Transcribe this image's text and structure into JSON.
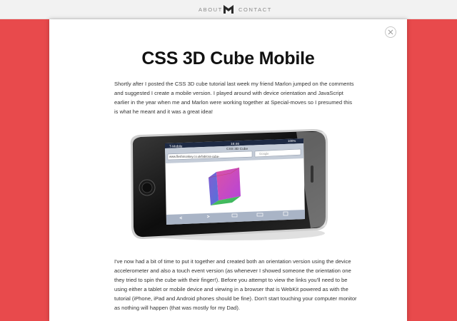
{
  "nav": {
    "about_label": "ABOUT",
    "contact_label": "CONTACT"
  },
  "article": {
    "title": "CSS 3D Cube Mobile",
    "intro": "Shortly after I posted the CSS 3D cube tutorial last week my friend Marlon jumped on the comments and suggested I create a mobile version. I played around with device orientation and JavaScript earlier in the year when me and Marlon were working together at Special-moves so I presumed this is what he meant and it was a great idea!",
    "body": "I've now had a bit of time to put it together and created both an orientation version using the device accelerometer and also a touch event version (as whenever I showed someone the orientation one they tried to spin the cube with their finger!). Before you attempt to view the links you'll need to be using either a tablet or mobile device and viewing in a browser that is WebKit powered as with the tutorial (iPhone, iPad and Android phones should be fine). Don't start touching your computer monitor as nothing will happen (that was mostly for my Dad)."
  },
  "phone_screen": {
    "carrier": "T-Mobile",
    "time": "16:46",
    "battery": "100%",
    "page_title": "CSS 3D Cube",
    "url": "www.fleshmonkey.co.uk/lab/css-cube-",
    "search_placeholder": "Google"
  },
  "colors": {
    "background": "#e84a4c",
    "topbar": "#f2f2f2",
    "card": "#ffffff"
  }
}
